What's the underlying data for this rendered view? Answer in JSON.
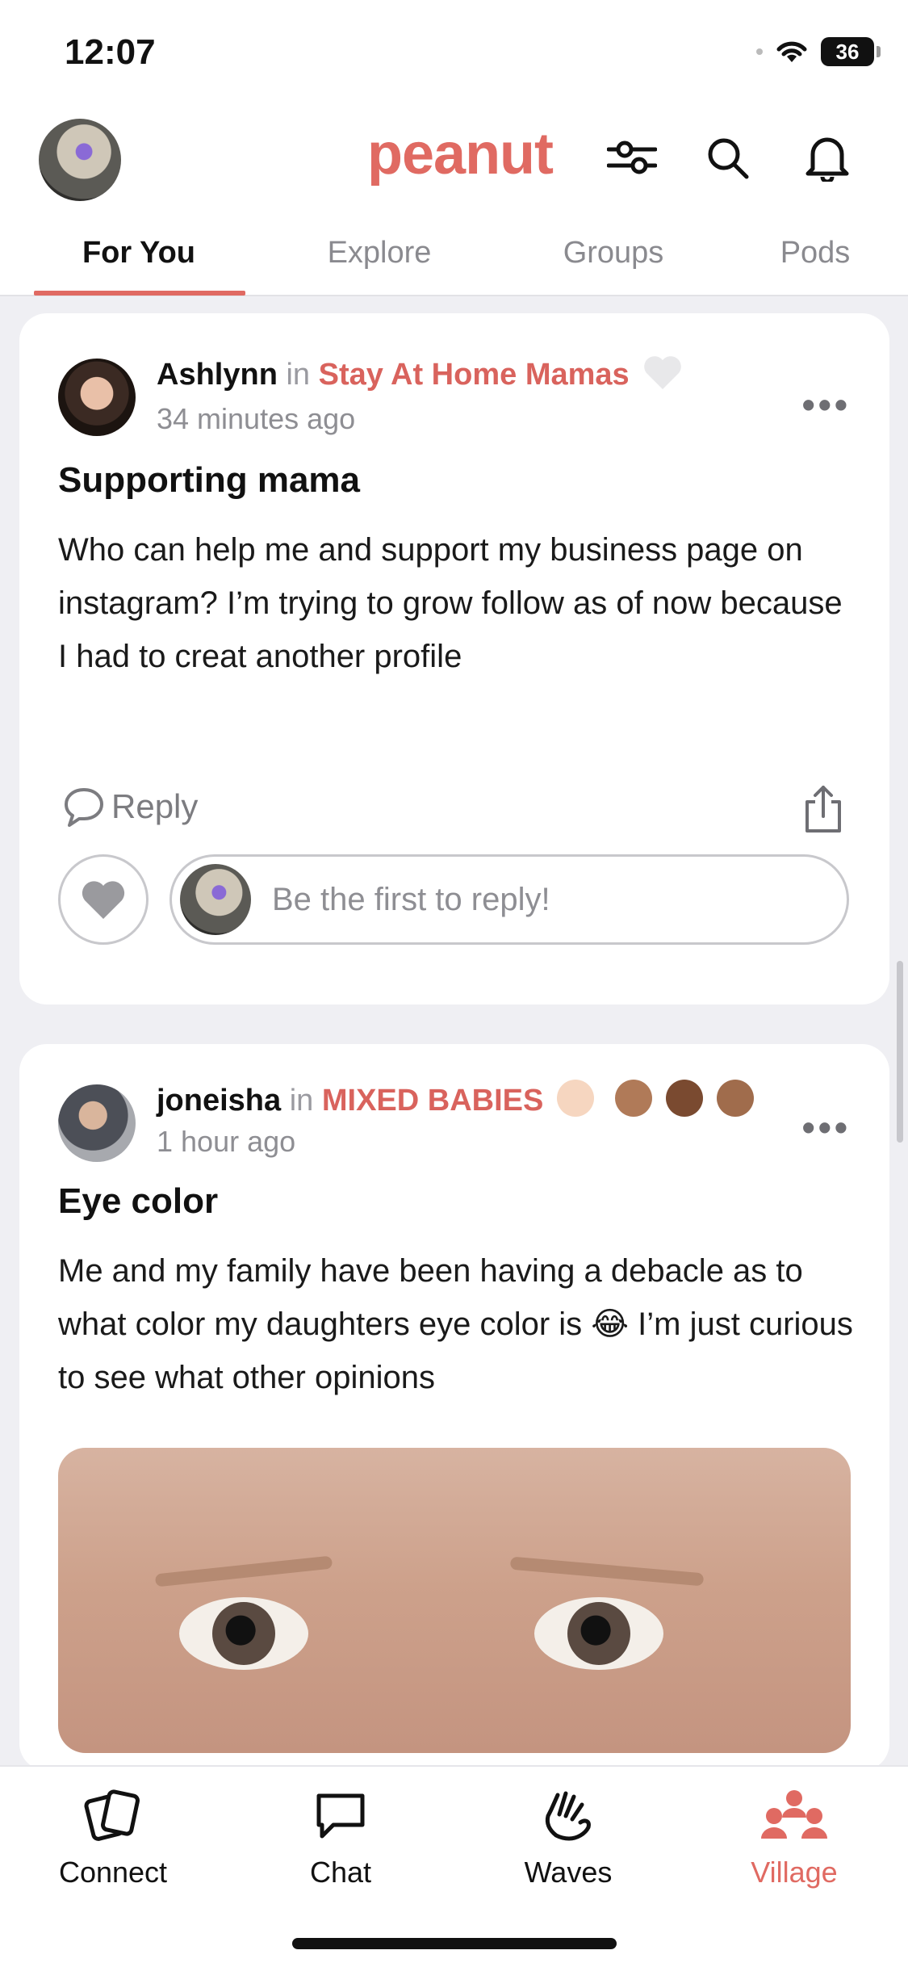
{
  "status": {
    "time": "12:07",
    "battery": "36"
  },
  "header": {
    "logo": "peanut"
  },
  "tabs": [
    {
      "label": "For You"
    },
    {
      "label": "Explore"
    },
    {
      "label": "Groups"
    },
    {
      "label": "Pods"
    }
  ],
  "posts": [
    {
      "author": "Ashlynn",
      "in": "in",
      "group": "Stay At Home Mamas",
      "time": "34 minutes ago",
      "title": "Supporting mama",
      "body": "Who can help me and support my business page on instagram? I’m trying to grow follow as of now because I had to creat another profile",
      "reply_label": "Reply",
      "reply_placeholder": "Be the first to reply!"
    },
    {
      "author": "joneisha",
      "in": "in",
      "group": "MIXED BABIES",
      "time": "1 hour ago",
      "title": "Eye color",
      "body": "Me and my family have been having a debacle as to what color my daughters eye color is 😂 I’m just curious to see what other opinions"
    }
  ],
  "nav": [
    {
      "label": "Connect"
    },
    {
      "label": "Chat"
    },
    {
      "label": "Waves"
    },
    {
      "label": "Village"
    }
  ],
  "colors": {
    "accent": "#e06a62",
    "muted": "#8e8e93"
  }
}
